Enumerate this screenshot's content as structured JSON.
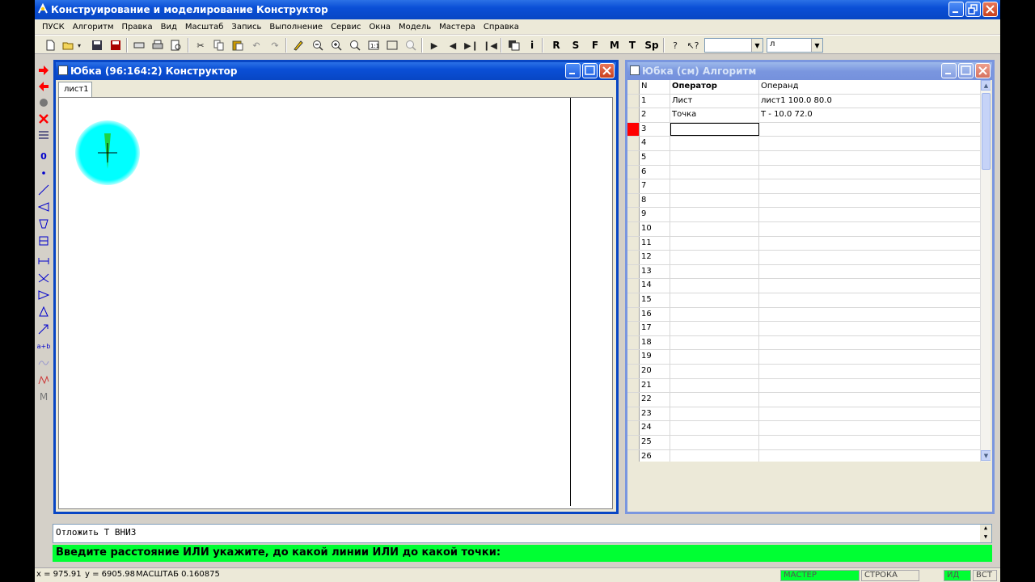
{
  "app": {
    "title": "Конструирование и моделирование  Конструктор"
  },
  "menu": [
    "ПУСК",
    "Алгоритм",
    "Правка",
    "Вид",
    "Масштаб",
    "Запись",
    "Выполнение",
    "Сервис",
    "Окна",
    "Модель",
    "Мастера",
    "Справка"
  ],
  "toolbar": {
    "text_buttons": [
      "R",
      "S",
      "F",
      "M",
      "T",
      "Sp"
    ],
    "info_button": "i",
    "combo1_value": "",
    "combo2_value": "л"
  },
  "left_tools": {
    "circle_label": "0",
    "ab_label": "a+b",
    "m_label": "M"
  },
  "constructor_window": {
    "title": "Юбка (96:164:2) Конструктор",
    "tab": "лист1"
  },
  "algorithm_window": {
    "title": "Юбка (см) Алгоритм",
    "headers": {
      "n": "N",
      "operator": "Оператор",
      "operand": "Операнд"
    },
    "rows": [
      {
        "n": "1",
        "operator": "Лист",
        "operand": "лист1 100.0 80.0"
      },
      {
        "n": "2",
        "operator": "Точка",
        "operand": "Т - 10.0 72.0"
      },
      {
        "n": "3",
        "operator": "",
        "operand": ""
      },
      {
        "n": "4",
        "operator": "",
        "operand": ""
      },
      {
        "n": "5",
        "operator": "",
        "operand": ""
      },
      {
        "n": "6",
        "operator": "",
        "operand": ""
      },
      {
        "n": "7",
        "operator": "",
        "operand": ""
      },
      {
        "n": "8",
        "operator": "",
        "operand": ""
      },
      {
        "n": "9",
        "operator": "",
        "operand": ""
      },
      {
        "n": "10",
        "operator": "",
        "operand": ""
      },
      {
        "n": "11",
        "operator": "",
        "operand": ""
      },
      {
        "n": "12",
        "operator": "",
        "operand": ""
      },
      {
        "n": "13",
        "operator": "",
        "operand": ""
      },
      {
        "n": "14",
        "operator": "",
        "operand": ""
      },
      {
        "n": "15",
        "operator": "",
        "operand": ""
      },
      {
        "n": "16",
        "operator": "",
        "operand": ""
      },
      {
        "n": "17",
        "operator": "",
        "operand": ""
      },
      {
        "n": "18",
        "operator": "",
        "operand": ""
      },
      {
        "n": "19",
        "operator": "",
        "operand": ""
      },
      {
        "n": "20",
        "operator": "",
        "operand": ""
      },
      {
        "n": "21",
        "operator": "",
        "operand": ""
      },
      {
        "n": "22",
        "operator": "",
        "operand": ""
      },
      {
        "n": "23",
        "operator": "",
        "operand": ""
      },
      {
        "n": "24",
        "operator": "",
        "operand": ""
      },
      {
        "n": "25",
        "operator": "",
        "operand": ""
      },
      {
        "n": "26",
        "operator": "",
        "operand": ""
      }
    ],
    "current_row": 3
  },
  "command": {
    "text": "Отложить  Т  ВНИЗ",
    "prompt": "Введите расстояние ИЛИ укажите, до какой линии ИЛИ до какой точки:"
  },
  "status": {
    "x": "x = 975.91",
    "y": "y = 6905.98",
    "scale": "МАСШТАБ 0.160875",
    "master": "МАСТЕР",
    "row": "СТРОКА",
    "id": "ИД",
    "ins": "ВСТ"
  },
  "colors": {
    "prompt_bg": "#00ff33",
    "marker": "#ff0000",
    "point_glow": "#00ffff"
  }
}
